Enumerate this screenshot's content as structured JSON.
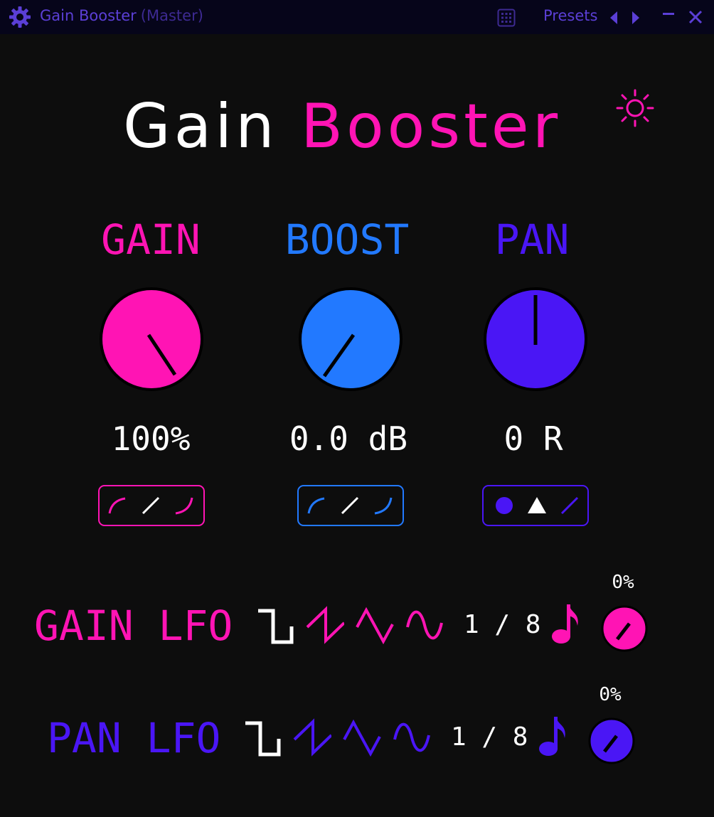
{
  "titlebar": {
    "title": "Gain Booster",
    "subtitle": "(Master)",
    "presets_label": "Presets"
  },
  "plugin": {
    "title_word1": "Gain",
    "title_word2": "Booster"
  },
  "colors": {
    "pink": "#ff14b4",
    "blue": "#2279ff",
    "purple": "#4a16f5",
    "background": "#0d0d0d"
  },
  "controls": {
    "gain": {
      "label": "GAIN",
      "value": "100%"
    },
    "boost": {
      "label": "BOOST",
      "value": "0.0 dB"
    },
    "pan": {
      "label": "PAN",
      "value": "0 R"
    }
  },
  "lfos": {
    "gain": {
      "label": "GAIN LFO",
      "rate": "1 / 8",
      "amount": "0%"
    },
    "pan": {
      "label": "PAN LFO",
      "rate": "1 / 8",
      "amount": "0%"
    }
  },
  "icons": [
    "app-gear-icon",
    "grid-icon",
    "prev-arrow-icon",
    "next-arrow-icon",
    "minimize-icon",
    "close-icon",
    "sun-icon",
    "music-note-icon"
  ]
}
